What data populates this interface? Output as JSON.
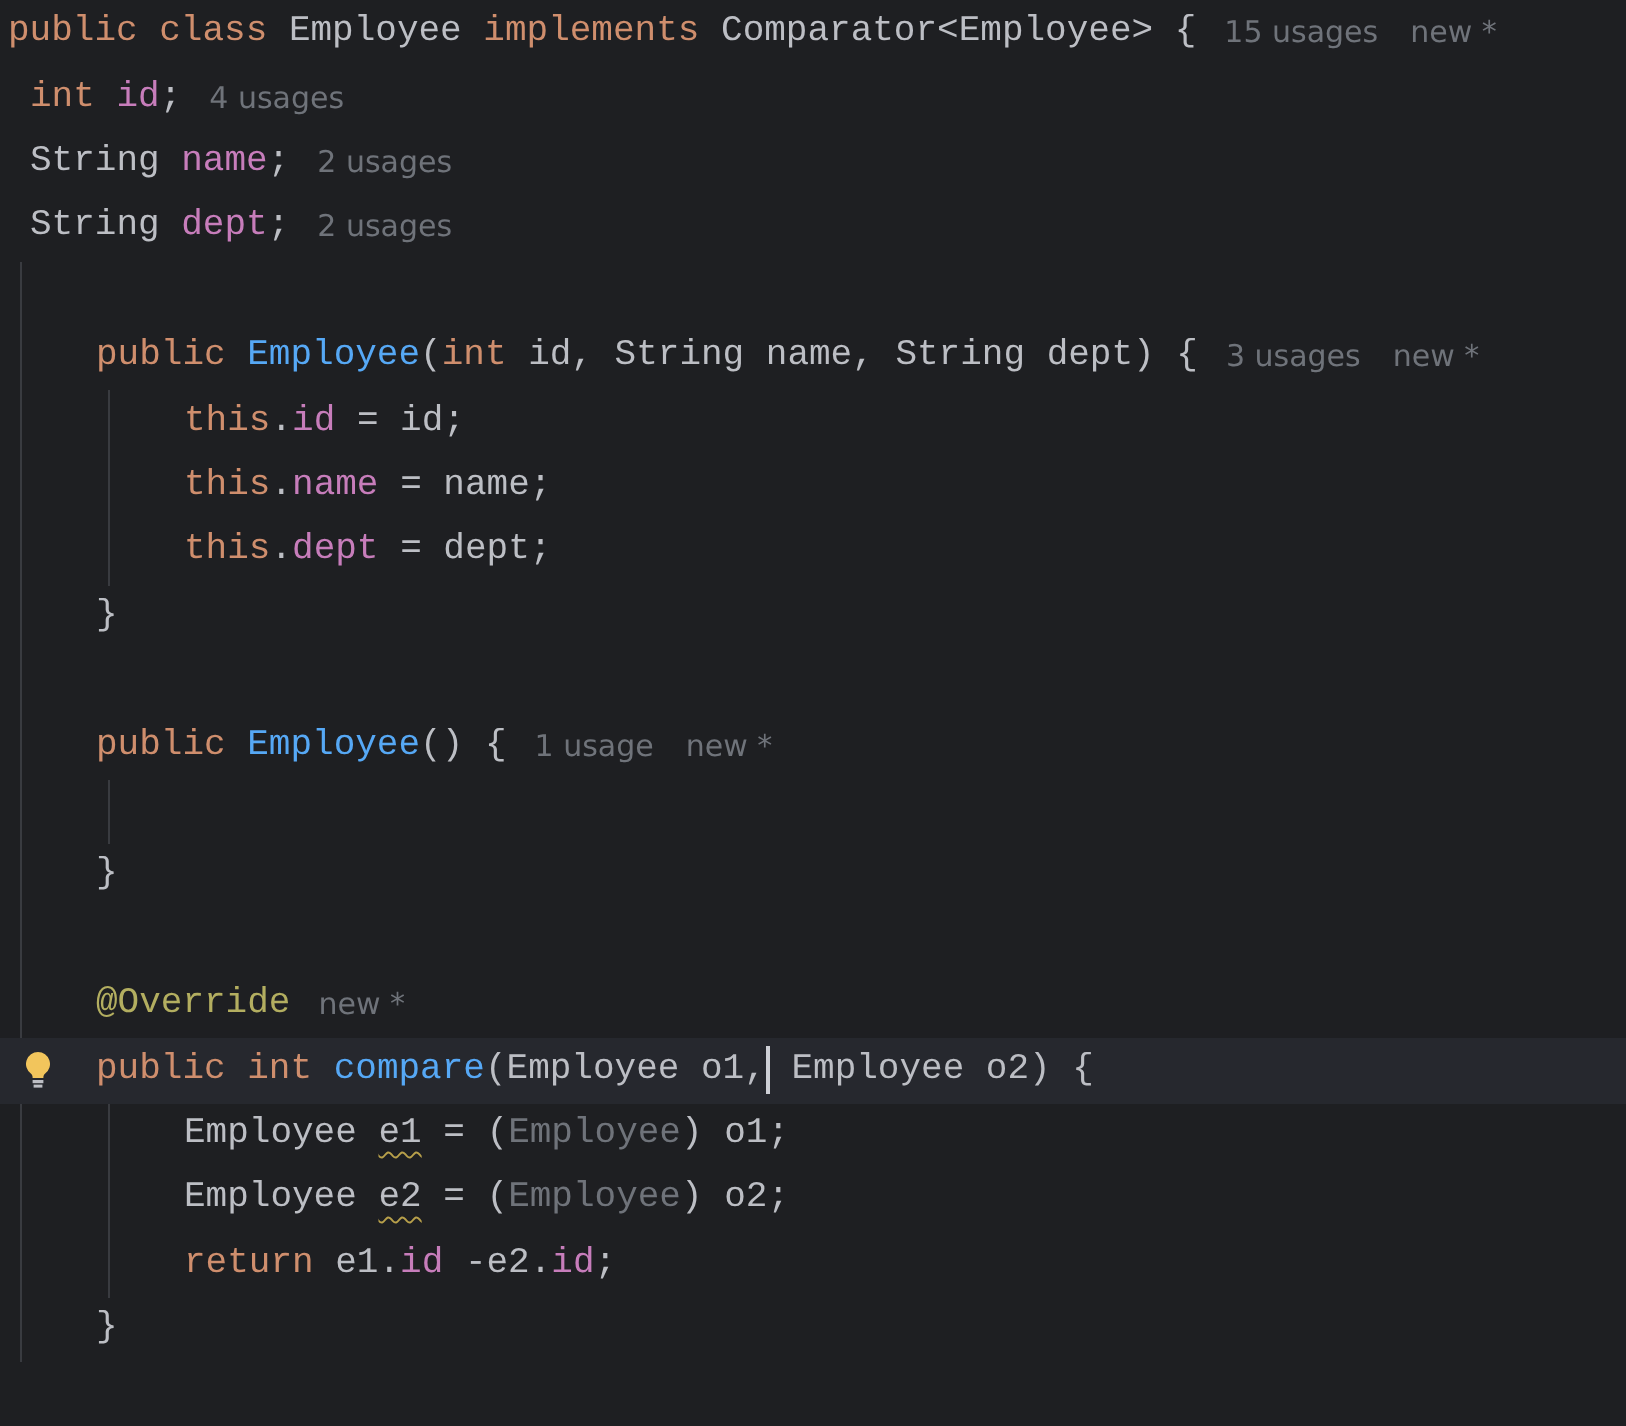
{
  "editor": {
    "lines": [
      {
        "kind": "code",
        "tokens": [
          {
            "kind": "keyword",
            "text": "public class"
          },
          {
            "kind": "plain",
            "text": " Employee"
          },
          {
            "kind": "keyword",
            "text": " implements"
          },
          {
            "kind": "plain",
            "text": " Comparator<Employee> {"
          }
        ],
        "hints": [
          "15 usages",
          "new *"
        ],
        "fields": [
          {
            "kind": "code",
            "tokens": [
              {
                "kind": "keyword",
                "text": "int"
              },
              {
                "kind": "field",
                "text": " id"
              },
              {
                "kind": "plain",
                "text": ";"
              }
            ],
            "hints": [
              "4 usages"
            ]
          },
          {
            "kind": "code",
            "tokens": [
              {
                "kind": "plain",
                "text": "String"
              },
              {
                "kind": "field",
                "text": " name"
              },
              {
                "kind": "plain",
                "text": ";"
              }
            ],
            "hints": [
              "2 usages"
            ]
          },
          {
            "kind": "code",
            "tokens": [
              {
                "kind": "plain",
                "text": "String"
              },
              {
                "kind": "field",
                "text": " dept"
              },
              {
                "kind": "plain",
                "text": ";"
              }
            ],
            "hints": [
              "2 usages"
            ]
          }
        ],
        "children": [
          {
            "kind": "blank"
          },
          {
            "kind": "code",
            "tokens": [
              {
                "kind": "keyword",
                "text": "public"
              },
              {
                "kind": "method",
                "text": " Employee"
              },
              {
                "kind": "plain",
                "text": "("
              },
              {
                "kind": "keyword",
                "text": "int"
              },
              {
                "kind": "plain",
                "text": " id, String name, String dept) {"
              }
            ],
            "hints": [
              "3 usages",
              "new *"
            ],
            "children": [
              {
                "kind": "code",
                "tokens": [
                  {
                    "kind": "keyword",
                    "text": "this"
                  },
                  {
                    "kind": "plain",
                    "text": "."
                  },
                  {
                    "kind": "field",
                    "text": "id"
                  },
                  {
                    "kind": "plain",
                    "text": " = id;"
                  }
                ]
              },
              {
                "kind": "code",
                "tokens": [
                  {
                    "kind": "keyword",
                    "text": "this"
                  },
                  {
                    "kind": "plain",
                    "text": "."
                  },
                  {
                    "kind": "field",
                    "text": "name"
                  },
                  {
                    "kind": "plain",
                    "text": " = name;"
                  }
                ]
              },
              {
                "kind": "code",
                "tokens": [
                  {
                    "kind": "keyword",
                    "text": "this"
                  },
                  {
                    "kind": "plain",
                    "text": "."
                  },
                  {
                    "kind": "field",
                    "text": "dept"
                  },
                  {
                    "kind": "plain",
                    "text": " = dept;"
                  }
                ]
              }
            ]
          },
          {
            "kind": "code",
            "tokens": [
              {
                "kind": "plain",
                "text": "}"
              }
            ]
          },
          {
            "kind": "blank"
          },
          {
            "kind": "code",
            "tokens": [
              {
                "kind": "keyword",
                "text": "public"
              },
              {
                "kind": "method",
                "text": " Employee"
              },
              {
                "kind": "plain",
                "text": "() {"
              }
            ],
            "hints": [
              "1 usage",
              "new *"
            ],
            "children": [
              {
                "kind": "blank"
              }
            ]
          },
          {
            "kind": "code",
            "tokens": [
              {
                "kind": "plain",
                "text": "}"
              }
            ]
          },
          {
            "kind": "blank"
          },
          {
            "kind": "code",
            "tokens": [
              {
                "kind": "annotation",
                "text": "@Override"
              }
            ],
            "hints": [
              "new *"
            ]
          },
          {
            "kind": "code",
            "current": true,
            "intention": true,
            "tokens": [
              {
                "kind": "keyword",
                "text": "public int"
              },
              {
                "kind": "method",
                "text": " compare"
              },
              {
                "kind": "plain",
                "text": "(Employee o1,",
                "caret": true
              },
              {
                "kind": "plain",
                "text": " Employee o2) {"
              }
            ],
            "children": [
              {
                "kind": "code",
                "tokens": [
                  {
                    "kind": "plain",
                    "text": "Employee"
                  },
                  {
                    "kind": "plain",
                    "text": " e1",
                    "warning": true
                  },
                  {
                    "kind": "plain",
                    "text": " = ("
                  },
                  {
                    "kind": "muted",
                    "text": "Employee"
                  },
                  {
                    "kind": "plain",
                    "text": ") o1;"
                  }
                ]
              },
              {
                "kind": "code",
                "tokens": [
                  {
                    "kind": "plain",
                    "text": "Employee"
                  },
                  {
                    "kind": "plain",
                    "text": " e2",
                    "warning": true
                  },
                  {
                    "kind": "plain",
                    "text": " = ("
                  },
                  {
                    "kind": "muted",
                    "text": "Employee"
                  },
                  {
                    "kind": "plain",
                    "text": ") o2;"
                  }
                ]
              },
              {
                "kind": "code",
                "tokens": [
                  {
                    "kind": "keyword",
                    "text": "return"
                  },
                  {
                    "kind": "plain",
                    "text": " e1."
                  },
                  {
                    "kind": "field",
                    "text": "id"
                  },
                  {
                    "kind": "plain",
                    "text": " -e2."
                  },
                  {
                    "kind": "field",
                    "text": "id"
                  },
                  {
                    "kind": "plain",
                    "text": ";"
                  }
                ]
              }
            ]
          },
          {
            "kind": "code",
            "tokens": [
              {
                "kind": "plain",
                "text": "}"
              }
            ]
          }
        ]
      }
    ]
  }
}
